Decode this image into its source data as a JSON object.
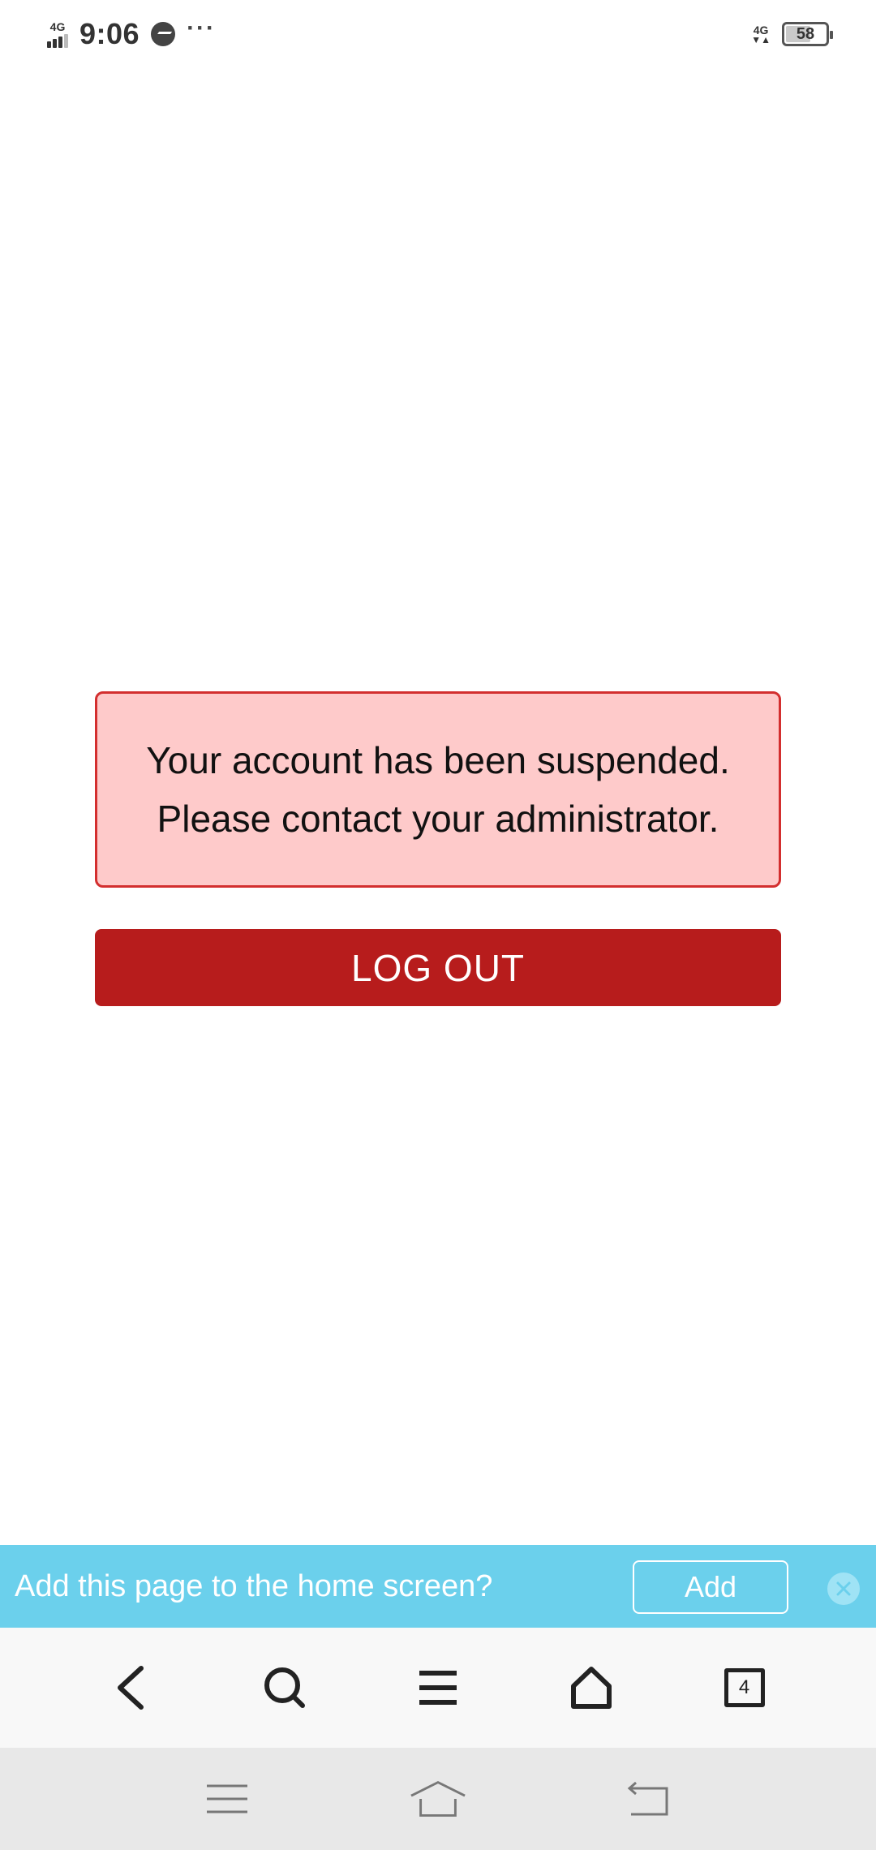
{
  "status_bar": {
    "network_left": "4G",
    "time": "9:06",
    "more": "···",
    "network_right": "4G",
    "battery": "58"
  },
  "alert": {
    "line1": "Your account has been suspended.",
    "line2": "Please contact your administrator."
  },
  "logout_button": "LOG OUT",
  "banner": {
    "prompt": "Add this page to the home screen?",
    "add_label": "Add"
  },
  "toolbar": {
    "tab_count": "4"
  },
  "colors": {
    "alert_bg": "#fecaca",
    "alert_border": "#d32f2f",
    "logout_bg": "#b71c1c",
    "banner_bg": "#6bd0ec"
  },
  "icons": [
    "back-icon",
    "search-icon",
    "menu-icon",
    "home-icon",
    "tabs-icon",
    "recent-apps-icon",
    "system-home-icon",
    "system-back-icon",
    "close-icon",
    "messenger-icon",
    "signal-icon",
    "battery-icon"
  ]
}
